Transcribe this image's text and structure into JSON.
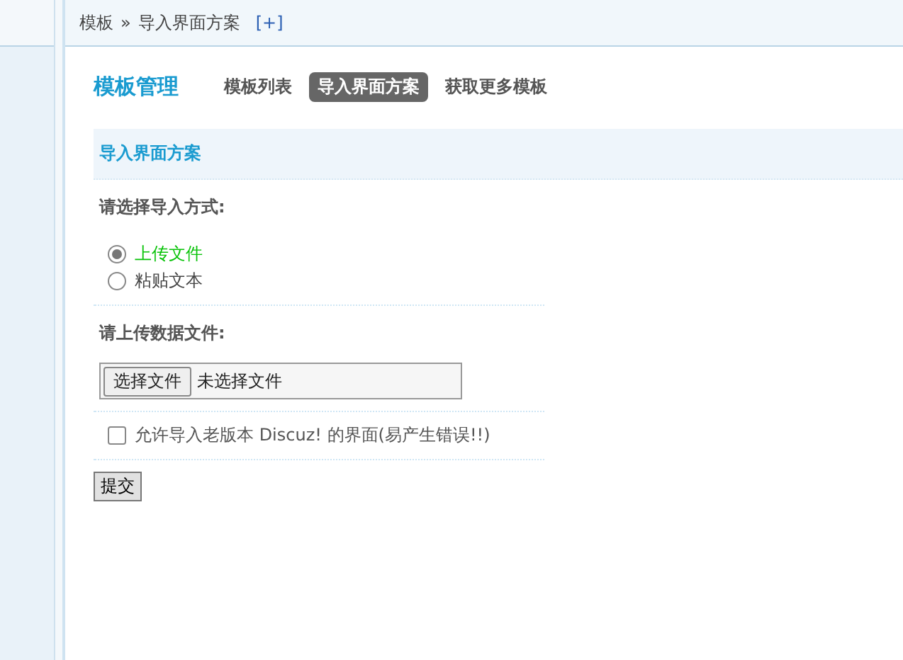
{
  "breadcrumb": {
    "items": [
      "模板",
      "导入界面方案"
    ],
    "separator": "»",
    "add_link": "[+]"
  },
  "nav": {
    "title": "模板管理",
    "tabs": [
      {
        "label": "模板列表",
        "selected": false
      },
      {
        "label": "导入界面方案",
        "selected": true
      },
      {
        "label": "获取更多模板",
        "selected": false
      }
    ]
  },
  "section": {
    "title": "导入界面方案"
  },
  "import_method": {
    "label": "请选择导入方式:",
    "options": [
      {
        "label": "上传文件",
        "selected": true
      },
      {
        "label": "粘贴文本",
        "selected": false
      }
    ]
  },
  "upload": {
    "label": "请上传数据文件:",
    "button": "选择文件",
    "status": "未选择文件"
  },
  "allow_old": {
    "label": "允许导入老版本 Discuz! 的界面(易产生错误!!)",
    "checked": false
  },
  "submit": "提交"
}
